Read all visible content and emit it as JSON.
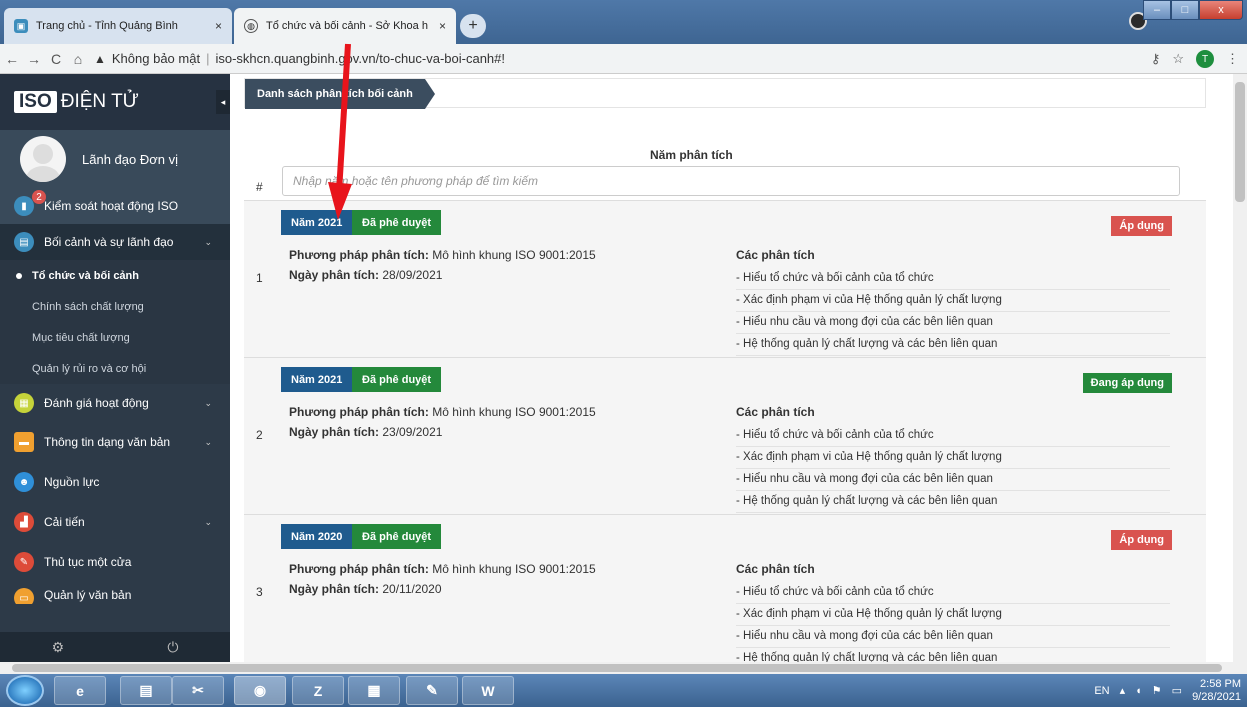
{
  "browser": {
    "tabs": [
      {
        "title": "Trang chủ - Tỉnh Quảng Bình",
        "close": "×"
      },
      {
        "title": "Tổ chức và bối cảnh - Sở Khoa h",
        "close": "×"
      }
    ],
    "new_tab": "+",
    "window_controls": {
      "minimize": "–",
      "maximize": "□",
      "close": "x"
    },
    "nav": {
      "back": "←",
      "forward": "→",
      "reload": "C",
      "home": "⌂"
    },
    "security": "Không bảo mật",
    "url": "iso-skhcn.quangbinh.gov.vn/to-chuc-va-boi-canh#!",
    "profile_initial": "T"
  },
  "sidebar": {
    "logo_iso": "ISO",
    "logo_text": "ĐIỆN TỬ",
    "user_name": "Lãnh đạo Đơn vị",
    "menu": [
      {
        "label": "Kiểm soát hoạt động ISO",
        "badge": "2",
        "color": "#3c8dbc"
      },
      {
        "label": "Bối cảnh và sự lãnh đạo",
        "color": "#3c8dbc",
        "chevron": "⌄"
      },
      {
        "label": "Đánh giá hoạt động",
        "color": "#c5d33a",
        "chevron": "⌄"
      },
      {
        "label": "Thông tin dạng văn bản",
        "color": "#f0a030",
        "chevron": "⌄"
      },
      {
        "label": "Nguồn lực",
        "color": "#2f8fd8"
      },
      {
        "label": "Cải tiến",
        "color": "#dd4b39",
        "chevron": "⌄"
      },
      {
        "label": "Thủ tục một cửa",
        "color": "#dd4b39"
      },
      {
        "label": "Quản lý văn bản",
        "color": "#f0a030"
      }
    ],
    "submenu": [
      {
        "label": "Tổ chức và bối cảnh",
        "current": true
      },
      {
        "label": "Chính sách chất lượng"
      },
      {
        "label": "Mục tiêu chất lượng"
      },
      {
        "label": "Quản lý rủi ro và cơ hội"
      }
    ]
  },
  "main": {
    "breadcrumb": "Danh sách phân tích bối cảnh",
    "column_header": "Năm phân tích",
    "hash": "#",
    "search_placeholder": "Nhập năm hoặc tên phương pháp để tìm kiếm",
    "method_label": "Phương pháp phân tích:",
    "date_label": "Ngày phân tích:",
    "analyses_title": "Các phân tích",
    "rows": [
      {
        "no": "1",
        "year": "Năm 2021",
        "status": "Đã phê duyệt",
        "apply": "Áp dụng",
        "apply_color": "#d9534f",
        "method": "Mô hình khung ISO 9001:2015",
        "date": "28/09/2021",
        "items": [
          "- Hiểu tổ chức và bối cảnh của tổ chức",
          "- Xác định phạm vi của Hệ thống quản lý chất lượng",
          "- Hiểu nhu cầu và mong đợi của các bên liên quan",
          "- Hệ thống quản lý chất lượng và các bên liên quan"
        ]
      },
      {
        "no": "2",
        "year": "Năm 2021",
        "status": "Đã phê duyệt",
        "apply": "Đang áp dụng",
        "apply_color": "#24893b",
        "method": "Mô hình khung ISO 9001:2015",
        "date": "23/09/2021",
        "items": [
          "- Hiểu tổ chức và bối cảnh của tổ chức",
          "- Xác định phạm vi của Hệ thống quản lý chất lượng",
          "- Hiểu nhu cầu và mong đợi của các bên liên quan",
          "- Hệ thống quản lý chất lượng và các bên liên quan"
        ]
      },
      {
        "no": "3",
        "year": "Năm 2020",
        "status": "Đã phê duyệt",
        "apply": "Áp dụng",
        "apply_color": "#d9534f",
        "method": "Mô hình khung ISO 9001:2015",
        "date": "20/11/2020",
        "items": [
          "- Hiểu tổ chức và bối cảnh của tổ chức",
          "- Xác định phạm vi của Hệ thống quản lý chất lượng",
          "- Hiểu nhu cầu và mong đợi của các bên liên quan",
          "- Hệ thống quản lý chất lượng và các bên liên quan"
        ]
      }
    ]
  },
  "taskbar": {
    "apps": [
      "IE",
      "Files",
      "Snip",
      "Chrome",
      "Zalo",
      "Photo",
      "Tools",
      "Word"
    ],
    "lang": "EN",
    "time": "2:58 PM",
    "date": "9/28/2021"
  }
}
